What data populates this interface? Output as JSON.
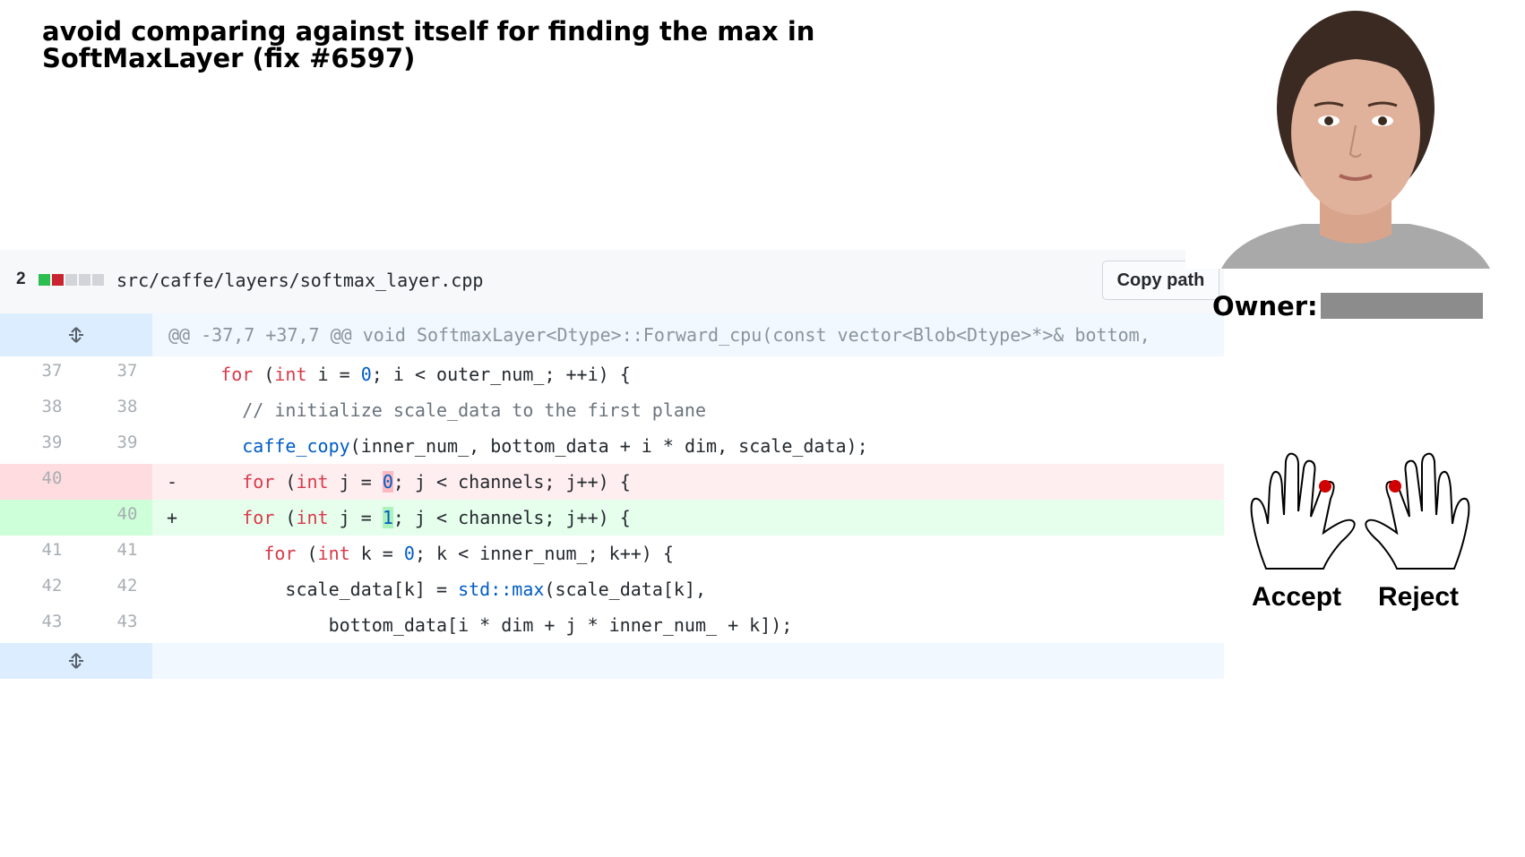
{
  "title": {
    "line1": "avoid comparing against itself for finding the max in",
    "line2": "SoftMaxLayer (fix #6597)"
  },
  "diff": {
    "changes_count": "2",
    "diffstat_colors": [
      "#2cbe4e",
      "#cb2431",
      "#d1d5da",
      "#d1d5da",
      "#d1d5da"
    ],
    "file_path": "src/caffe/layers/softmax_layer.cpp",
    "copy_label": "Copy path",
    "hunk_header": "@@ -37,7 +37,7 @@ void SoftmaxLayer<Dtype>::Forward_cpu(const vector<Blob<Dtype>*>& bottom,",
    "lines": [
      {
        "old": "37",
        "new": "37",
        "type": "ctx"
      },
      {
        "old": "38",
        "new": "38",
        "type": "ctx"
      },
      {
        "old": "39",
        "new": "39",
        "type": "ctx"
      },
      {
        "old": "40",
        "new": "",
        "type": "del",
        "sign": "-"
      },
      {
        "old": "",
        "new": "40",
        "type": "add",
        "sign": "+"
      },
      {
        "old": "41",
        "new": "41",
        "type": "ctx"
      },
      {
        "old": "42",
        "new": "42",
        "type": "ctx"
      },
      {
        "old": "43",
        "new": "43",
        "type": "ctx"
      }
    ],
    "code": {
      "l37": {
        "kw1": "for",
        "p1": " (",
        "kw2": "int",
        "p2": " i = ",
        "n1": "0",
        "p3": "; i < outer_num_; ++i) {"
      },
      "l38": {
        "comment": "// initialize scale_data to the first plane"
      },
      "l39": {
        "fn": "caffe_copy",
        "rest": "(inner_num_, bottom_data + i * dim, scale_data);"
      },
      "l40del": {
        "kw1": "for",
        "p1": " (",
        "kw2": "int",
        "p2": " j = ",
        "n1": "0",
        "p3": "; j < channels; j++) {"
      },
      "l40add": {
        "kw1": "for",
        "p1": " (",
        "kw2": "int",
        "p2": " j = ",
        "n1": "1",
        "p3": "; j < channels; j++) {"
      },
      "l41": {
        "kw1": "for",
        "p1": " (",
        "kw2": "int",
        "p2": " k = ",
        "n1": "0",
        "p3": "; k < inner_num_; k++) {"
      },
      "l42": {
        "p1": "scale_data[k] = ",
        "fn": "std::max",
        "p2": "(scale_data[k],"
      },
      "l43": {
        "p1": "bottom_data[i * dim + j * inner_num_ + k]);"
      }
    }
  },
  "owner": {
    "label": "Owner:",
    "redact_color": "#8c8c8c"
  },
  "gestures": {
    "accept_label": "Accept",
    "reject_label": "Reject",
    "marker_color": "#d00000"
  }
}
